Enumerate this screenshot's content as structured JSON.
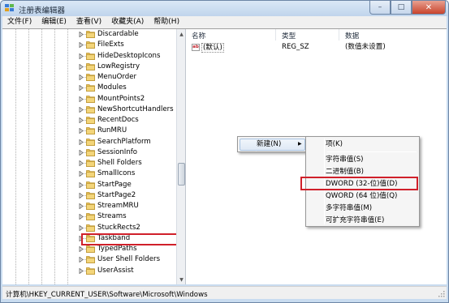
{
  "window": {
    "title": "注册表编辑器",
    "minimize": "–",
    "maximize": "□",
    "close": "✕"
  },
  "menu": [
    "文件(F)",
    "编辑(E)",
    "查看(V)",
    "收藏夹(A)",
    "帮助(H)"
  ],
  "tree": {
    "items": [
      "Discardable",
      "FileExts",
      "HideDesktopIcons",
      "LowRegistry",
      "MenuOrder",
      "Modules",
      "MountPoints2",
      "NewShortcutHandlers",
      "RecentDocs",
      "RunMRU",
      "SearchPlatform",
      "SessionInfo",
      "Shell Folders",
      "SmallIcons",
      "StartPage",
      "StartPage2",
      "StreamMRU",
      "Streams",
      "StuckRects2",
      "Taskband",
      "TypedPaths",
      "User Shell Folders",
      "UserAssist"
    ],
    "selected": "Taskband"
  },
  "columns": {
    "name": "名称",
    "type": "类型",
    "data": "数据"
  },
  "values": [
    {
      "icon": "ab",
      "name": "(默认)",
      "type": "REG_SZ",
      "data": "(数值未设置)"
    }
  ],
  "context_menu": {
    "new_label": "新建(N)",
    "submenu_arrow": "▶"
  },
  "new_submenu": {
    "key": "项(K)",
    "items": [
      "字符串值(S)",
      "二进制值(B)",
      "DWORD (32-位)值(D)",
      "QWORD (64 位)值(Q)",
      "多字符串值(M)",
      "可扩充字符串值(E)"
    ],
    "highlighted": "DWORD (32-位)值(D)"
  },
  "status": {
    "path": "计算机\\HKEY_CURRENT_USER\\Software\\Microsoft\\Windows"
  },
  "colors": {
    "highlight_border": "#d0202a",
    "folder": "#e8c15a",
    "titlebar": "#c9dcf0"
  }
}
